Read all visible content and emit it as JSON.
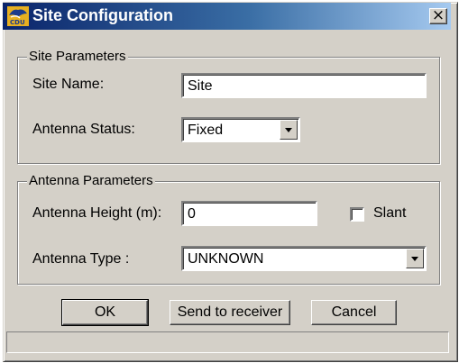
{
  "window": {
    "title": "Site Configuration",
    "close_symbol": "×",
    "icon": "cdu-app-icon"
  },
  "site_parameters": {
    "legend": "Site Parameters",
    "site_name_label": "Site Name:",
    "site_name_value": "Site",
    "antenna_status_label": "Antenna Status:",
    "antenna_status_value": "Fixed"
  },
  "antenna_parameters": {
    "legend": "Antenna Parameters",
    "height_label": "Antenna Height (m):",
    "height_value": "0",
    "slant_label": "Slant",
    "slant_checked": false,
    "type_label": "Antenna Type :",
    "type_value": "UNKNOWN"
  },
  "buttons": {
    "ok": "OK",
    "send": "Send to receiver",
    "cancel": "Cancel"
  },
  "statusbar": {
    "text": ""
  }
}
